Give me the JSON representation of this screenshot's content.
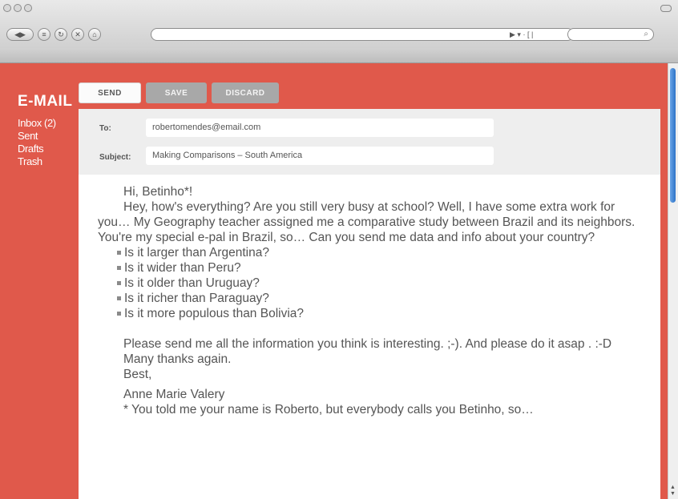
{
  "browser": {
    "back_glyph": "◀",
    "forward_glyph": "▶",
    "menu_glyph": "≡",
    "reload_glyph": "↻",
    "stop_glyph": "✕",
    "home_glyph": "⌂",
    "addr_tools_glyph": "▶ ▾ · [ |",
    "search_glyph": "⌕"
  },
  "app": {
    "logo": "E-MAIL",
    "folders": [
      "Inbox (2)",
      "Sent",
      "Drafts",
      "Trash"
    ],
    "actions": {
      "send": "SEND",
      "save": "SAVE",
      "discard": "DISCARD"
    }
  },
  "message": {
    "to_label": "To:",
    "to_value": "robertomendes@email.com",
    "subject_label": "Subject:",
    "subject_value": "Making Comparisons – South America",
    "greeting": "Hi, Betinho*!",
    "paragraph1": "Hey, how's everything? Are you still very busy at school? Well, I have some extra work for you… My Geography teacher assigned me a comparative study between Brazil and its neighbors. You're my special e-pal in Brazil, so… Can you send me data and info about your country?",
    "questions": [
      "Is it larger than Argentina?",
      "Is it wider than Peru?",
      "Is it older than Uruguay?",
      "Is it richer than Paraguay?",
      "Is it more populous than Bolivia?"
    ],
    "paragraph2": "Please send me all the information you think is interesting. ;-). And please do it asap . :-D",
    "thanks": "Many thanks again.",
    "closing": "Best,",
    "signature": "Anne Marie Valery",
    "footnote": "* You told me your name is Roberto, but everybody calls you Betinho, so…"
  },
  "colors": {
    "accent": "#e0594b",
    "button_grey": "#a8a8a8",
    "panel": "#eeeeee",
    "text": "#555555"
  }
}
